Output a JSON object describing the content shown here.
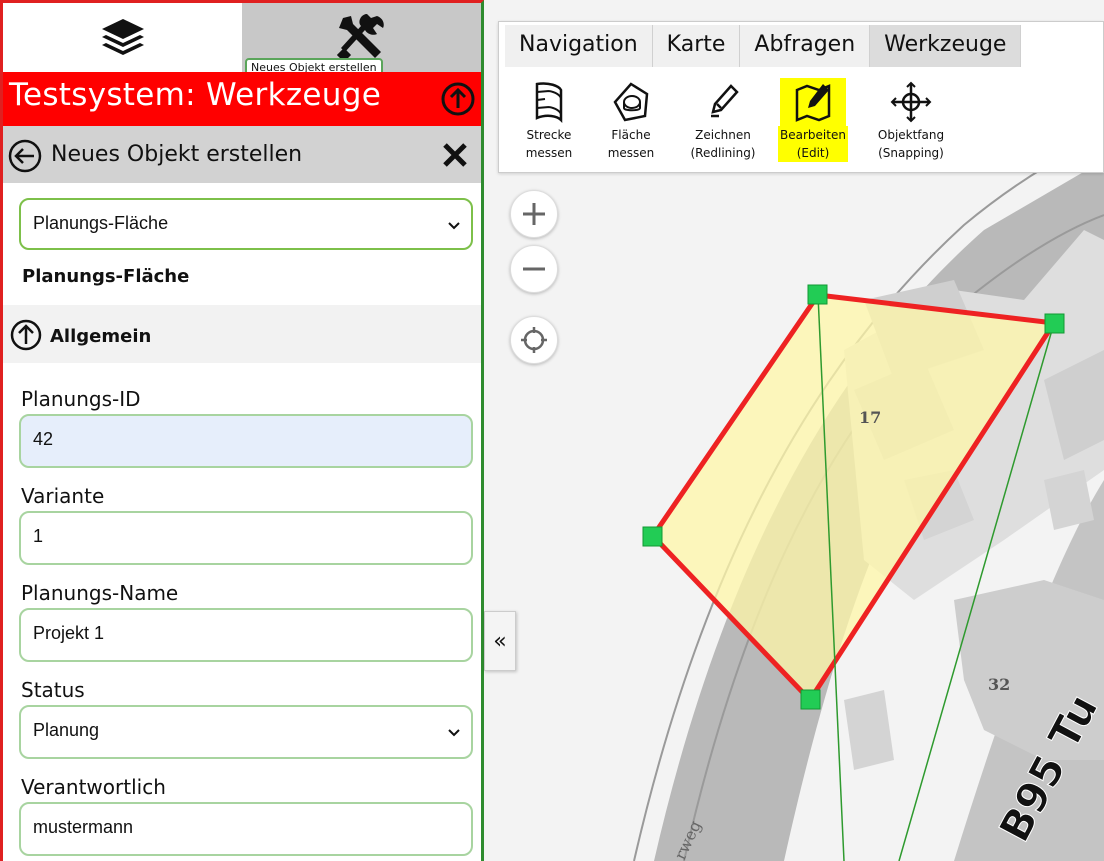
{
  "panel": {
    "tooltip": "Neues Objekt erstellen",
    "title": "Testsystem: Werkzeuge",
    "subheader": "Neues Objekt erstellen",
    "object_type_select": "Planungs-Fläche",
    "object_type_label": "Planungs-Fläche",
    "section": "Allgemein",
    "fields": [
      {
        "label": "Planungs-ID",
        "value": "42"
      },
      {
        "label": "Variante",
        "value": "1"
      },
      {
        "label": "Planungs-Name",
        "value": "Projekt 1"
      },
      {
        "label": "Status",
        "value": "Planung"
      },
      {
        "label": "Verantwortlich",
        "value": "mustermann"
      }
    ],
    "icons": [
      "layers-icon",
      "tools-icon",
      "arrow-up-circle-icon",
      "arrow-left-circle-icon",
      "close-icon",
      "chevron-down-icon"
    ]
  },
  "toolbar": {
    "tabs": [
      "Navigation",
      "Karte",
      "Abfragen",
      "Werkzeuge"
    ],
    "selected_tab": "Werkzeuge",
    "tools": [
      {
        "line1": "Strecke",
        "line2": "messen"
      },
      {
        "line1": "Fläche",
        "line2": "messen"
      },
      {
        "line1": "Zeichnen",
        "line2": "(Redlining)"
      },
      {
        "line1": "Bearbeiten",
        "line2": "(Edit)"
      },
      {
        "line1": "Objektfang",
        "line2": "(Snapping)"
      }
    ],
    "highlight_color": "#ffff00"
  },
  "map": {
    "house_number_1": "17",
    "house_number_2": "32",
    "road_label": "B95 Tu",
    "street_label": "rweg",
    "polygon_stroke": "#ee2222",
    "polygon_fill": "#fff7a8",
    "vertex_color": "#22cc55"
  },
  "collapse_label": "«"
}
